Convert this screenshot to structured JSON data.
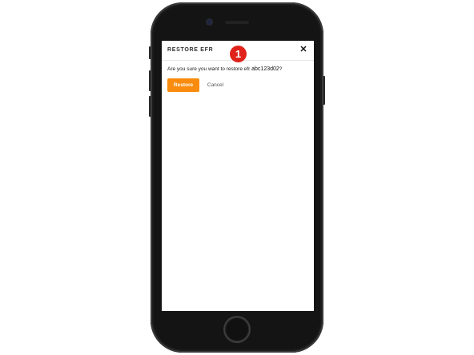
{
  "dialog": {
    "title": "RESTORE EFR",
    "close_icon": "close-icon",
    "close_glyph": "✕",
    "message_prefix": "Are you sure you want to restore efr ",
    "efr_id": "abc123d02",
    "message_suffix": "?",
    "restore_label": "Restore",
    "cancel_label": "Cancel"
  },
  "step_badge": {
    "number": "1",
    "color": "#e0221a"
  },
  "colors": {
    "accent": "#f98c0e",
    "device_body": "#141414",
    "screen": "#ffffff"
  }
}
